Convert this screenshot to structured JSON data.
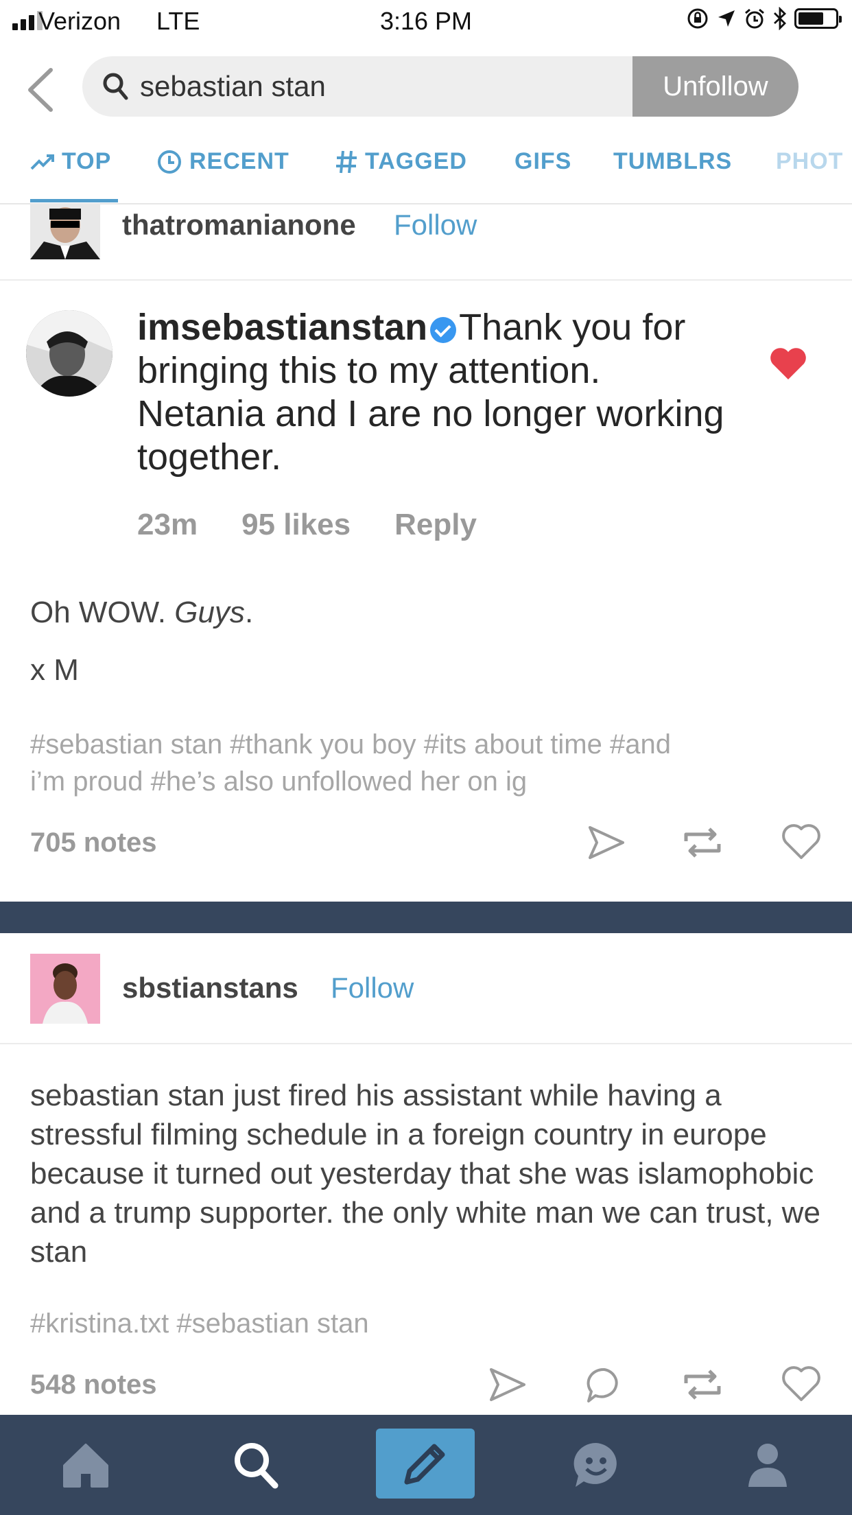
{
  "status_bar": {
    "carrier": "Verizon",
    "network": "LTE",
    "time": "3:16 PM"
  },
  "search": {
    "query": "sebastian stan",
    "unfollow_label": "Unfollow"
  },
  "tabs": [
    {
      "label": "TOP",
      "icon": "trending-icon",
      "active": true
    },
    {
      "label": "RECENT",
      "icon": "clock-icon"
    },
    {
      "label": "TAGGED",
      "icon": "hashtag-icon"
    },
    {
      "label": "GIFS"
    },
    {
      "label": "TUMBLRS"
    },
    {
      "label": "PHOT"
    }
  ],
  "posts": [
    {
      "username": "thatromanianone",
      "follow_label": "Follow",
      "quote": {
        "username": "imsebastianstan",
        "text": "Thank you for bringing this to my attention. Netania and I are no longer working together.",
        "time": "23m",
        "likes": "95 likes",
        "reply_label": "Reply"
      },
      "body_line1_plain": "Oh WOW. ",
      "body_line1_italic": "Guys",
      "body_line1_end": ".",
      "body_line2": "x M",
      "tags_line1": "#sebastian stan  #thank you boy  #its about time  #and",
      "tags_line2": "i’m proud  #he’s also unfollowed her on ig",
      "notes": "705 notes"
    },
    {
      "username": "sbstianstans",
      "follow_label": "Follow",
      "body": "sebastian stan just fired his assistant while having a stressful filming schedule in a foreign country in europe because it turned out yesterday that she was islamophobic and a trump supporter. the only white man we can trust, we stan",
      "tags": "#kristina.txt  #sebastian stan",
      "notes": "548 notes"
    }
  ],
  "nav": [
    "home-icon",
    "search-icon",
    "compose-icon",
    "messaging-icon",
    "account-icon"
  ],
  "colors": {
    "accent": "#529ecc",
    "nav_bg": "#36465d",
    "heart": "#e8414d"
  }
}
